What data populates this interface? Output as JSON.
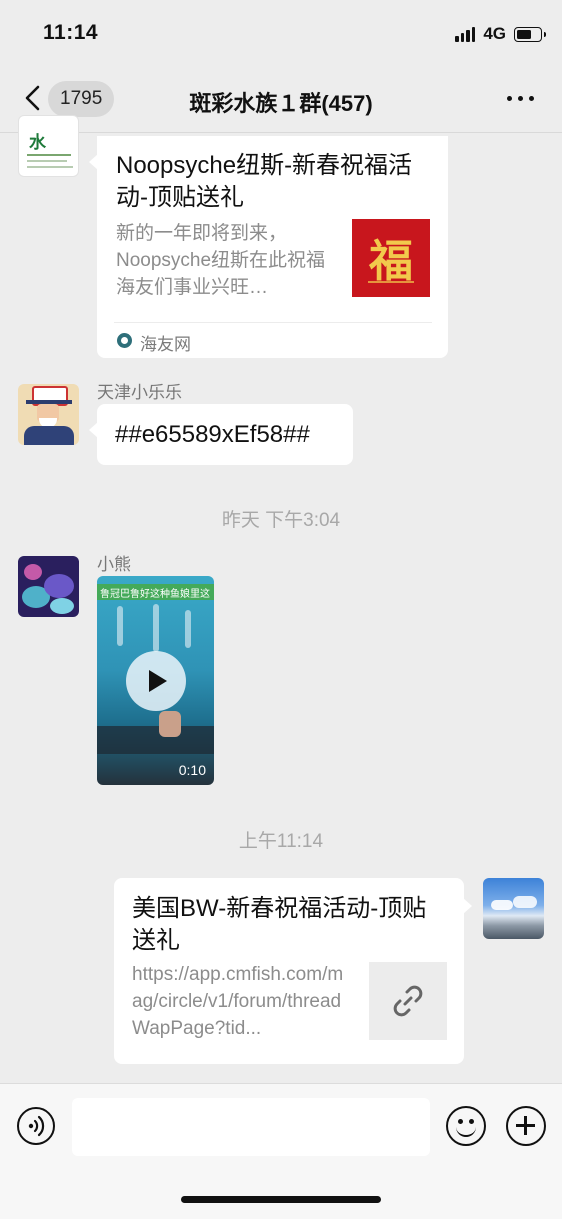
{
  "status_bar": {
    "time": "11:14",
    "network": "4G"
  },
  "header": {
    "back_count": "1795",
    "title": "斑彩水族１群(457)"
  },
  "messages": [
    {
      "type": "link-card",
      "avatar_text": "水",
      "title": "Noopsyche纽斯-新春祝福活动-顶贴送礼",
      "description": "新的一年即将到来，Noopsyche纽斯在此祝福海友们事业兴旺…",
      "thumbnail_text": "福",
      "source": "海友网"
    },
    {
      "type": "text",
      "sender": "天津小乐乐",
      "text": "##e65589xEf58##"
    },
    {
      "type": "timestamp",
      "text": "昨天 下午3:04"
    },
    {
      "type": "video",
      "sender": "小熊",
      "caption": "鲁冠巴鲁好这种鱼娘里这",
      "duration": "0:10"
    },
    {
      "type": "timestamp",
      "text": "上午11:14"
    },
    {
      "type": "link-card-self",
      "title": "美国BW-新春祝福活动-顶贴送礼",
      "url": "https://app.cmfish.com/mag/circle/v1/forum/threadWapPage?tid..."
    }
  ],
  "colors": {
    "background": "#ededed",
    "bubble": "#ffffff",
    "fu_red": "#c8161d",
    "fu_gold": "#f2c94c"
  },
  "icons": [
    "back-chevron-icon",
    "more-dots-icon",
    "voice-icon",
    "emoji-icon",
    "add-icon",
    "play-icon",
    "link-icon",
    "source-logo-icon"
  ]
}
